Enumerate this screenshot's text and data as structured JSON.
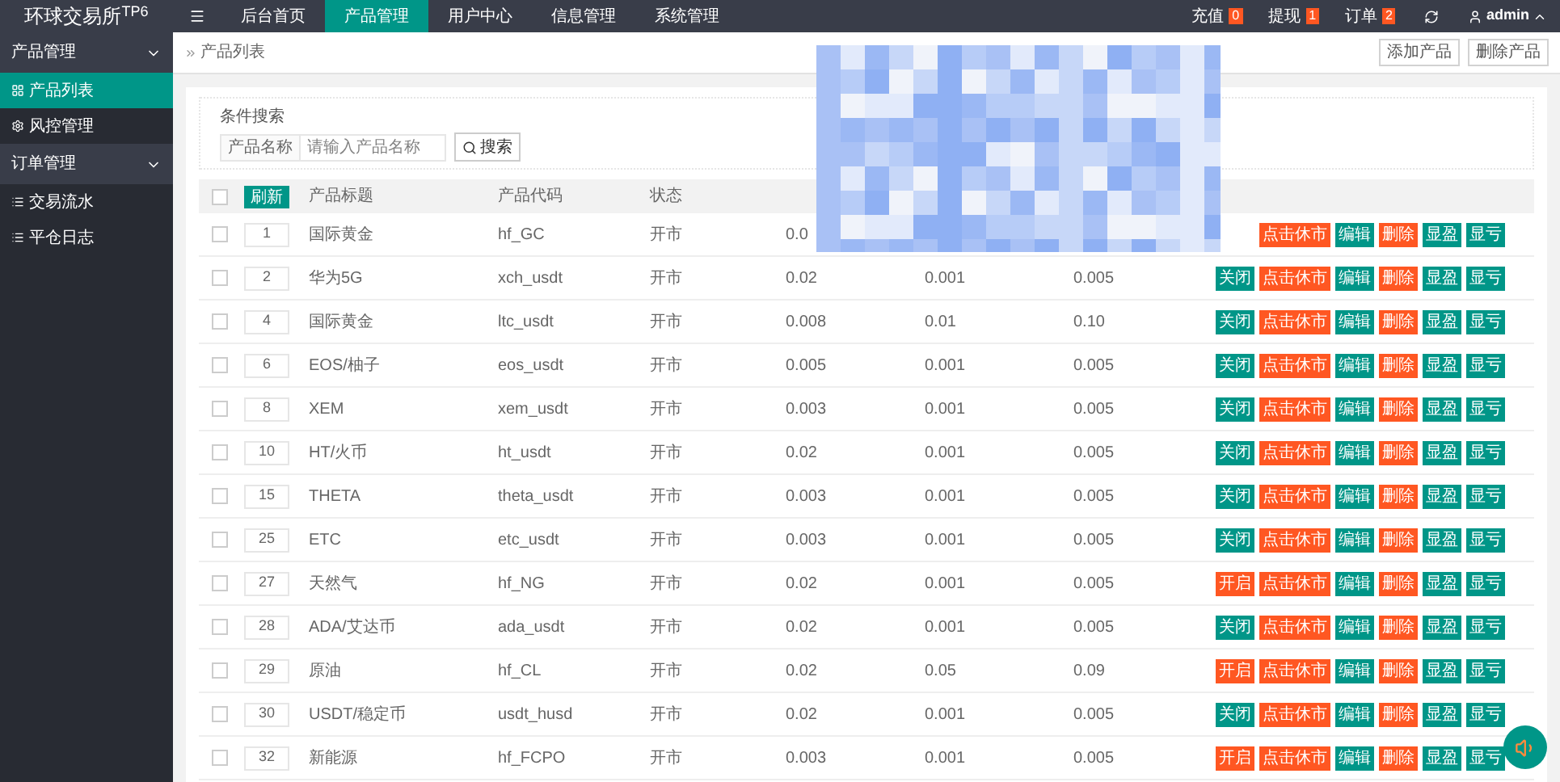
{
  "logo": "环球交易所$^{TP6}$",
  "top_menu": [
    {
      "label": "后台首页",
      "selected": false
    },
    {
      "label": "产品管理",
      "selected": true
    },
    {
      "label": "用户中心",
      "selected": false
    },
    {
      "label": "信息管理",
      "selected": false
    },
    {
      "label": "系统管理",
      "selected": false
    }
  ],
  "top_right": {
    "counters": [
      {
        "label": "充值",
        "count": "0"
      },
      {
        "label": "提现",
        "count": "1"
      },
      {
        "label": "订单",
        "count": "2"
      }
    ],
    "user": "admin"
  },
  "sidebar": [
    {
      "label": "产品管理",
      "expanded": true,
      "children": [
        {
          "label": "产品列表",
          "selected": true
        },
        {
          "label": "风控管理",
          "selected": false
        }
      ]
    },
    {
      "label": "订单管理",
      "expanded": true,
      "children": [
        {
          "label": "交易流水",
          "selected": false
        },
        {
          "label": "平仓日志",
          "selected": false
        }
      ]
    }
  ],
  "breadcrumb": "产品列表",
  "page_buttons": [
    "添加产品",
    "删除产品"
  ],
  "search": {
    "legend": "条件搜索",
    "label": "产品名称",
    "placeholder": "请输入产品名称",
    "button": "搜索"
  },
  "table": {
    "refresh": "刷新",
    "all_checked": false,
    "columns": [
      "产品标题",
      "产品代码",
      "状态"
    ],
    "rows": [
      {
        "checked": false,
        "id": "1",
        "title": "国际黄金",
        "code": "hf_GC",
        "status": "开市",
        "column_4": "0.0",
        "actions": [
          {
            "label": "点击休市",
            "kind": "danger"
          },
          {
            "label": "编辑",
            "kind": "primary"
          },
          {
            "label": "删除",
            "kind": "danger"
          },
          {
            "label": "显盈",
            "kind": "primary"
          },
          {
            "label": "显亏",
            "kind": "primary"
          }
        ]
      },
      {
        "checked": false,
        "id": "2",
        "title": "华为5G",
        "code": "xch_usdt",
        "status": "开市",
        "column_4": "0.02",
        "column_5": "0.001",
        "column_6": "0.005",
        "actions": [
          {
            "label": "关闭",
            "kind": "primary"
          },
          {
            "label": "点击休市",
            "kind": "danger"
          },
          {
            "label": "编辑",
            "kind": "primary"
          },
          {
            "label": "删除",
            "kind": "danger"
          },
          {
            "label": "显盈",
            "kind": "primary"
          },
          {
            "label": "显亏",
            "kind": "primary"
          }
        ]
      },
      {
        "checked": false,
        "id": "4",
        "title": "国际黄金",
        "code": "ltc_usdt",
        "status": "开市",
        "column_4": "0.008",
        "column_5": "0.01",
        "column_6": "0.10",
        "actions": [
          {
            "label": "关闭",
            "kind": "primary"
          },
          {
            "label": "点击休市",
            "kind": "danger"
          },
          {
            "label": "编辑",
            "kind": "primary"
          },
          {
            "label": "删除",
            "kind": "danger"
          },
          {
            "label": "显盈",
            "kind": "primary"
          },
          {
            "label": "显亏",
            "kind": "primary"
          }
        ]
      },
      {
        "checked": false,
        "id": "6",
        "title": "EOS/柚子",
        "code": "eos_usdt",
        "status": "开市",
        "column_4": "0.005",
        "column_5": "0.001",
        "column_6": "0.005",
        "actions": [
          {
            "label": "关闭",
            "kind": "primary"
          },
          {
            "label": "点击休市",
            "kind": "danger"
          },
          {
            "label": "编辑",
            "kind": "primary"
          },
          {
            "label": "删除",
            "kind": "danger"
          },
          {
            "label": "显盈",
            "kind": "primary"
          },
          {
            "label": "显亏",
            "kind": "primary"
          }
        ]
      },
      {
        "checked": false,
        "id": "8",
        "title": "XEM",
        "code": "xem_usdt",
        "status": "开市",
        "column_4": "0.003",
        "column_5": "0.001",
        "column_6": "0.005",
        "actions": [
          {
            "label": "关闭",
            "kind": "primary"
          },
          {
            "label": "点击休市",
            "kind": "danger"
          },
          {
            "label": "编辑",
            "kind": "primary"
          },
          {
            "label": "删除",
            "kind": "danger"
          },
          {
            "label": "显盈",
            "kind": "primary"
          },
          {
            "label": "显亏",
            "kind": "primary"
          }
        ]
      },
      {
        "checked": false,
        "id": "10",
        "title": "HT/火币",
        "code": "ht_usdt",
        "status": "开市",
        "column_4": "0.02",
        "column_5": "0.001",
        "column_6": "0.005",
        "actions": [
          {
            "label": "关闭",
            "kind": "primary"
          },
          {
            "label": "点击休市",
            "kind": "danger"
          },
          {
            "label": "编辑",
            "kind": "primary"
          },
          {
            "label": "删除",
            "kind": "danger"
          },
          {
            "label": "显盈",
            "kind": "primary"
          },
          {
            "label": "显亏",
            "kind": "primary"
          }
        ]
      },
      {
        "checked": false,
        "id": "15",
        "title": "THETA",
        "code": "theta_usdt",
        "status": "开市",
        "column_4": "0.003",
        "column_5": "0.001",
        "column_6": "0.005",
        "actions": [
          {
            "label": "关闭",
            "kind": "primary"
          },
          {
            "label": "点击休市",
            "kind": "danger"
          },
          {
            "label": "编辑",
            "kind": "primary"
          },
          {
            "label": "删除",
            "kind": "danger"
          },
          {
            "label": "显盈",
            "kind": "primary"
          },
          {
            "label": "显亏",
            "kind": "primary"
          }
        ]
      },
      {
        "checked": false,
        "id": "25",
        "title": "ETC",
        "code": "etc_usdt",
        "status": "开市",
        "column_4": "0.003",
        "column_5": "0.001",
        "column_6": "0.005",
        "actions": [
          {
            "label": "关闭",
            "kind": "primary"
          },
          {
            "label": "点击休市",
            "kind": "danger"
          },
          {
            "label": "编辑",
            "kind": "primary"
          },
          {
            "label": "删除",
            "kind": "danger"
          },
          {
            "label": "显盈",
            "kind": "primary"
          },
          {
            "label": "显亏",
            "kind": "primary"
          }
        ]
      },
      {
        "checked": false,
        "id": "27",
        "title": "天然气",
        "code": "hf_NG",
        "status": "开市",
        "column_4": "0.02",
        "column_5": "0.001",
        "column_6": "0.005",
        "actions": [
          {
            "label": "开启",
            "kind": "danger"
          },
          {
            "label": "点击休市",
            "kind": "danger"
          },
          {
            "label": "编辑",
            "kind": "primary"
          },
          {
            "label": "删除",
            "kind": "danger"
          },
          {
            "label": "显盈",
            "kind": "primary"
          },
          {
            "label": "显亏",
            "kind": "primary"
          }
        ]
      },
      {
        "checked": false,
        "id": "28",
        "title": "ADA/艾达币",
        "code": "ada_usdt",
        "status": "开市",
        "column_4": "0.02",
        "column_5": "0.001",
        "column_6": "0.005",
        "actions": [
          {
            "label": "关闭",
            "kind": "primary"
          },
          {
            "label": "点击休市",
            "kind": "danger"
          },
          {
            "label": "编辑",
            "kind": "primary"
          },
          {
            "label": "删除",
            "kind": "danger"
          },
          {
            "label": "显盈",
            "kind": "primary"
          },
          {
            "label": "显亏",
            "kind": "primary"
          }
        ]
      },
      {
        "checked": false,
        "id": "29",
        "title": "原油",
        "code": "hf_CL",
        "status": "开市",
        "column_4": "0.02",
        "column_5": "0.05",
        "column_6": "0.09",
        "actions": [
          {
            "label": "开启",
            "kind": "danger"
          },
          {
            "label": "点击休市",
            "kind": "danger"
          },
          {
            "label": "编辑",
            "kind": "primary"
          },
          {
            "label": "删除",
            "kind": "danger"
          },
          {
            "label": "显盈",
            "kind": "primary"
          },
          {
            "label": "显亏",
            "kind": "primary"
          }
        ]
      },
      {
        "checked": false,
        "id": "30",
        "title": "USDT/稳定币",
        "code": "usdt_husd",
        "status": "开市",
        "column_4": "0.02",
        "column_5": "0.001",
        "column_6": "0.005",
        "actions": [
          {
            "label": "关闭",
            "kind": "primary"
          },
          {
            "label": "点击休市",
            "kind": "danger"
          },
          {
            "label": "编辑",
            "kind": "primary"
          },
          {
            "label": "删除",
            "kind": "danger"
          },
          {
            "label": "显盈",
            "kind": "primary"
          },
          {
            "label": "显亏",
            "kind": "primary"
          }
        ]
      },
      {
        "checked": false,
        "id": "32",
        "title": "新能源",
        "code": "hf_FCPO",
        "status": "开市",
        "column_4": "0.003",
        "column_5": "0.001",
        "column_6": "0.005",
        "actions": [
          {
            "label": "开启",
            "kind": "danger"
          },
          {
            "label": "点击休市",
            "kind": "danger"
          },
          {
            "label": "编辑",
            "kind": "primary"
          },
          {
            "label": "删除",
            "kind": "danger"
          },
          {
            "label": "显盈",
            "kind": "primary"
          },
          {
            "label": "显亏",
            "kind": "primary"
          }
        ]
      }
    ]
  }
}
